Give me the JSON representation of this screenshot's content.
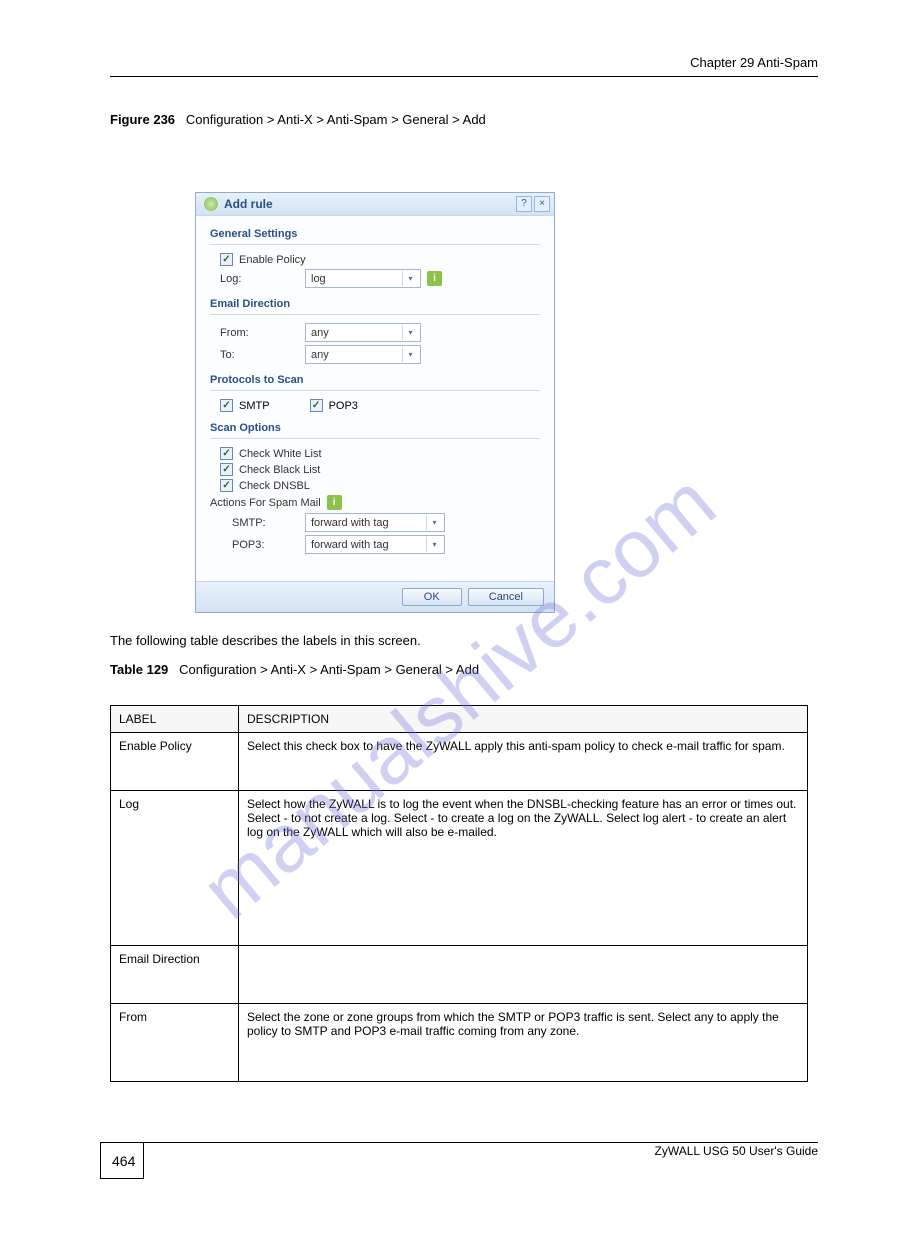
{
  "header": {
    "chapter": "Chapter 29 Anti-Spam"
  },
  "figure": {
    "number": "Figure 236",
    "title": "Configuration > Anti-X > Anti-Spam > General > Add"
  },
  "dialog": {
    "title": "Add rule",
    "help_tooltip": "?",
    "close_tooltip": "×",
    "sections": {
      "general": {
        "head": "General Settings",
        "enable_label": "Enable Policy",
        "log_label": "Log:",
        "log_value": "log"
      },
      "direction": {
        "head": "Email Direction",
        "from_label": "From:",
        "from_value": "any",
        "to_label": "To:",
        "to_value": "any"
      },
      "protocols": {
        "head": "Protocols to Scan",
        "smtp_label": "SMTP",
        "pop3_label": "POP3"
      },
      "scan": {
        "head": "Scan Options",
        "whitelist_label": "Check White List",
        "blacklist_label": "Check Black List",
        "dnsbl_label": "Check DNSBL",
        "actions_head": "Actions For Spam Mail",
        "smtp_label": "SMTP:",
        "smtp_value": "forward with tag",
        "pop3_label": "POP3:",
        "pop3_value": "forward with tag"
      }
    },
    "buttons": {
      "ok": "OK",
      "cancel": "Cancel"
    }
  },
  "table": {
    "intro": "The following table describes the labels in this screen.",
    "caption_num": "Table 129",
    "caption_title": "Configuration > Anti-X > Anti-Spam > General > Add",
    "head_label": "LABEL",
    "head_desc": "DESCRIPTION",
    "rows": [
      {
        "label": "Enable Policy",
        "desc": "Select this check box to have the ZyWALL apply this anti-spam policy to check e-mail traffic for spam."
      },
      {
        "label": "Log",
        "desc": "Select how the ZyWALL is to log the event when the DNSBL-checking feature has an error or times out. Select  -  to not create a log. Select  -  to create a log on the ZyWALL. Select   log alert  -  to create an alert log on the ZyWALL which will also be e-mailed."
      },
      {
        "label": "Email Direction",
        "desc": ""
      },
      {
        "label": "From",
        "desc": "Select the zone or zone groups from which the SMTP or POP3 traffic is sent. Select   any   to apply the policy to SMTP and POP3 e-mail traffic coming from any zone."
      }
    ]
  },
  "footer": {
    "page": "464",
    "guide": "ZyWALL USG 50 User's Guide"
  },
  "watermark": "manualshive.com"
}
